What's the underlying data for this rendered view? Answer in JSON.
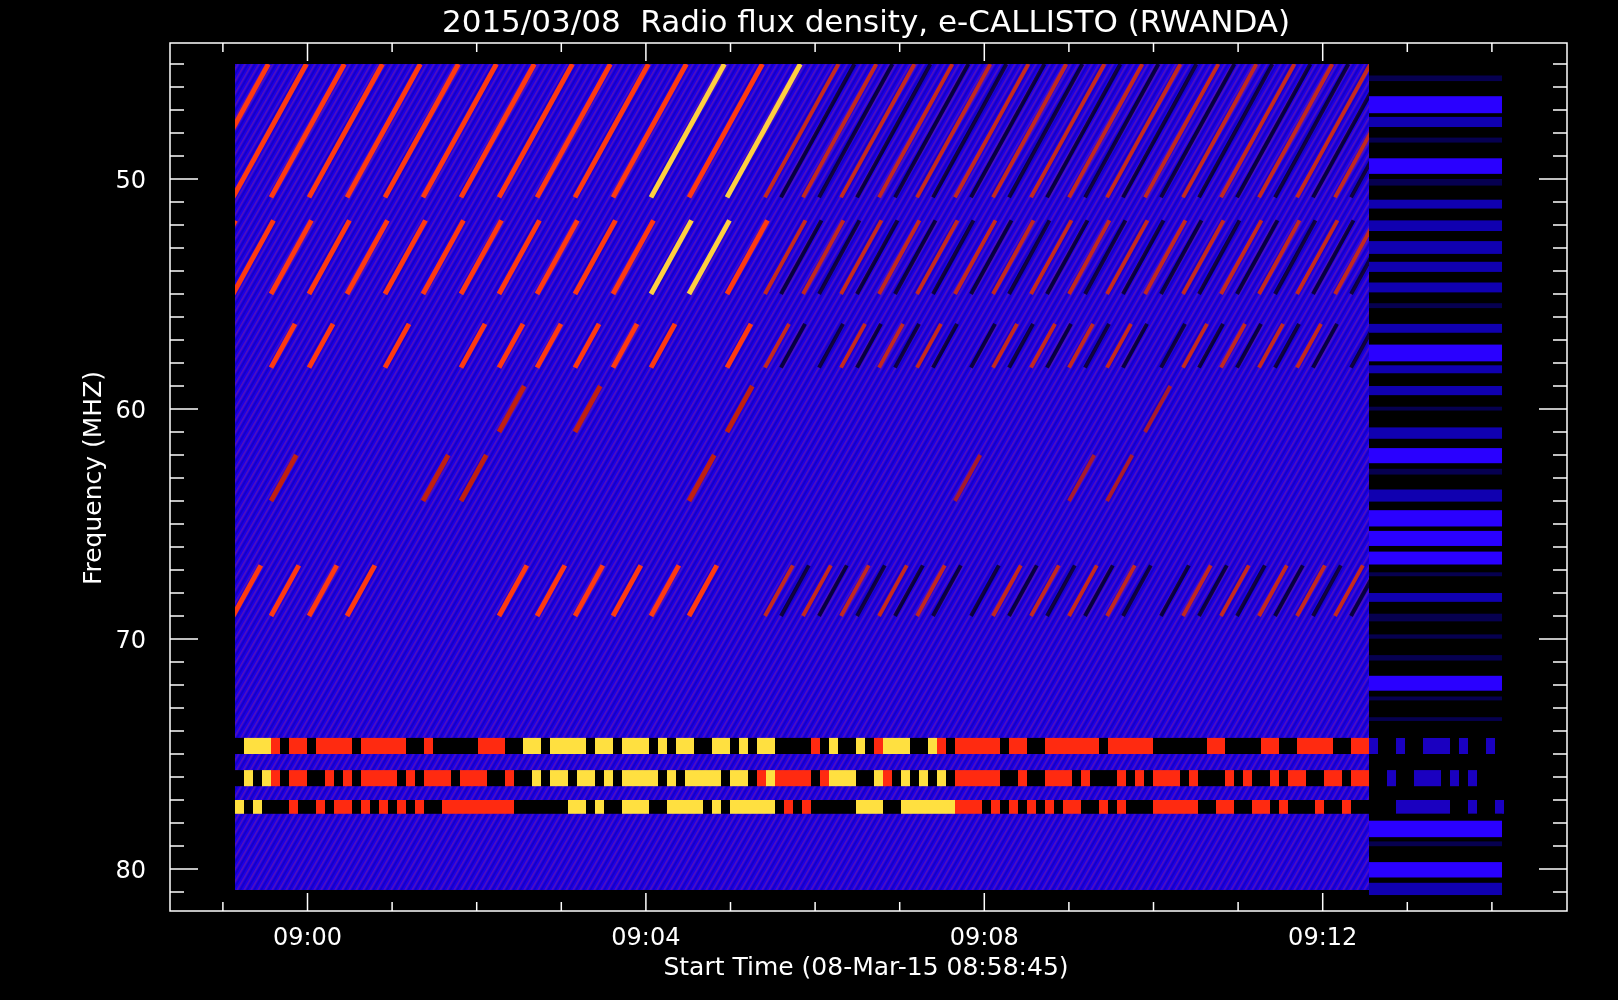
{
  "title": "2015/03/08  Radio flux density, e-CALLISTO (RWANDA)",
  "x_axis": {
    "label": "Start Time (08-Mar-15 08:58:45)",
    "ticks": [
      "09:00",
      "09:04",
      "09:08",
      "09:12"
    ]
  },
  "y_axis": {
    "label": "Frequency (MHZ)",
    "ticks": [
      "50",
      "60",
      "70",
      "80"
    ]
  }
}
